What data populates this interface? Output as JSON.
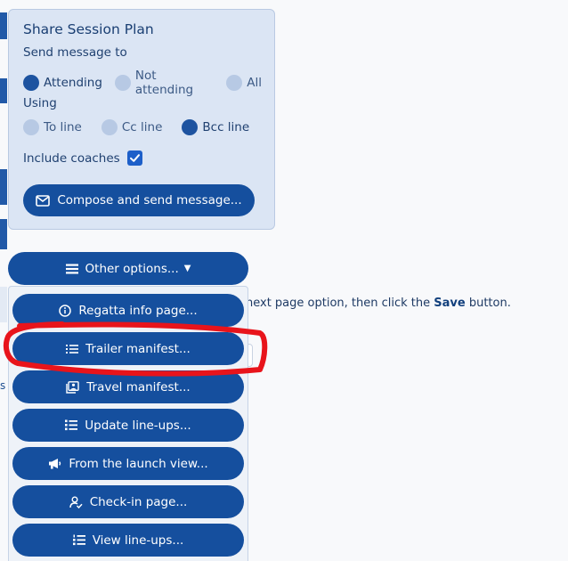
{
  "share": {
    "title": "Share Session Plan",
    "send_label": "Send message to",
    "send_options": [
      {
        "label": "Attending",
        "selected": true
      },
      {
        "label": "Not attending",
        "selected": false
      },
      {
        "label": "All",
        "selected": false
      }
    ],
    "using_label": "Using",
    "using_options": [
      {
        "label": "To line",
        "selected": false
      },
      {
        "label": "Cc line",
        "selected": false
      },
      {
        "label": "Bcc line",
        "selected": true
      }
    ],
    "coaches_label": "Include coaches",
    "coaches_checked": true,
    "compose_label": "Compose and send message..."
  },
  "other_options_label": "Other options...",
  "menu_items": [
    {
      "label": "Regatta info page...",
      "icon": "info-icon"
    },
    {
      "label": "Trailer manifest...",
      "icon": "list-icon"
    },
    {
      "label": "Travel manifest...",
      "icon": "images-icon"
    },
    {
      "label": "Update line-ups...",
      "icon": "list-check-icon"
    },
    {
      "label": "From the launch view...",
      "icon": "megaphone-icon"
    },
    {
      "label": "Check-in page...",
      "icon": "user-check-icon"
    },
    {
      "label": "View line-ups...",
      "icon": "list-ol-icon"
    }
  ],
  "background_text": {
    "instruction_pre": "next page option, then click the",
    "instruction_bold": "Save",
    "instruction_post": "button.",
    "side_letter": "s"
  },
  "colors": {
    "primary": "#154f9e",
    "card": "#dbe5f4",
    "annotation": "#e8141b"
  }
}
